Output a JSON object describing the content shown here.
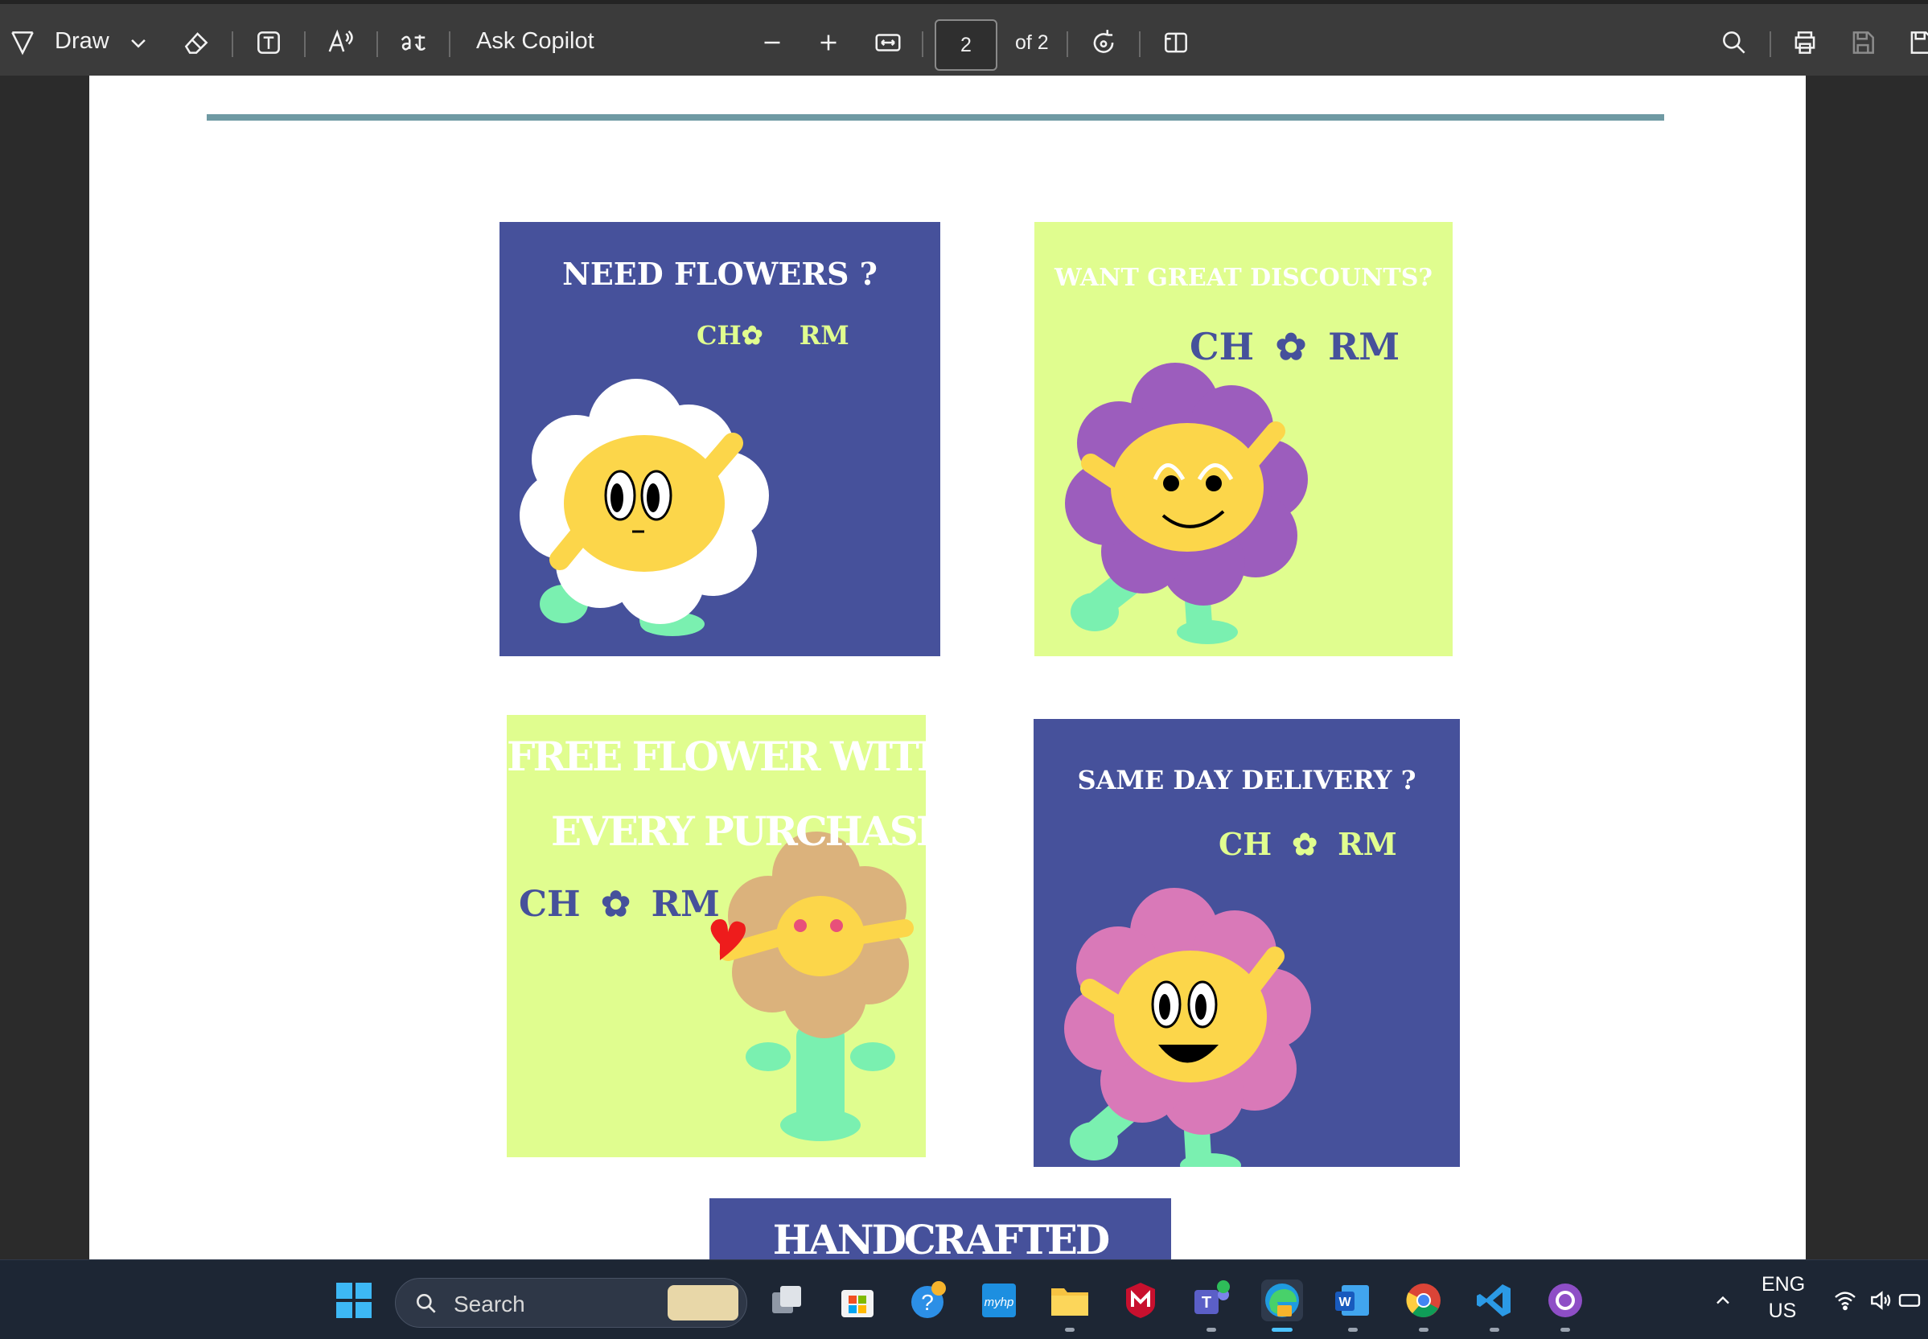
{
  "toolbar": {
    "draw_label": "Draw",
    "ask_copilot_label": "Ask Copilot",
    "page_current": "2",
    "page_total_label": "of 2",
    "icons": [
      "draw-icon",
      "chevron-down-icon",
      "eraser-icon",
      "text-box-icon",
      "read-aloud-icon",
      "translate-icon",
      "zoom-out-icon",
      "zoom-in-icon",
      "fit-width-icon",
      "rotate-icon",
      "page-view-icon",
      "search-icon",
      "print-icon",
      "save-icon",
      "save-as-icon"
    ]
  },
  "document": {
    "cards": [
      {
        "title": "NEED FLOWERS ?",
        "logo_left": "CH",
        "logo_right": "RM",
        "bg": "#46519b",
        "petal_color": "#ffffff"
      },
      {
        "title": "WANT GREAT DISCOUNTS?",
        "logo_left": "CH",
        "logo_right": "RM",
        "bg": "#e0fd8f",
        "petal_color": "#9c5dbd"
      },
      {
        "title_line1": "FREE FLOWER WITH",
        "title_line2": "EVERY PURCHASE @",
        "logo_left": "CH",
        "logo_right": "RM",
        "bg": "#e0fd8f",
        "petal_color": "#dbb27c"
      },
      {
        "title": "SAME DAY DELIVERY ?",
        "logo_left": "CH",
        "logo_right": "RM",
        "bg": "#46519b",
        "petal_color": "#d979b8"
      },
      {
        "title": "HANDCRAFTED",
        "bg": "#46519b"
      }
    ],
    "colors": {
      "navy": "#46519b",
      "lime": "#e0fd8f",
      "face": "#fcd64a",
      "leg": "#7af0b0",
      "rule": "#6f9aa3"
    }
  },
  "taskbar": {
    "search_placeholder": "Search",
    "lang_line1": "ENG",
    "lang_line2": "US",
    "apps": [
      "windows-start",
      "task-view",
      "microsoft-store",
      "get-help",
      "myhp",
      "file-explorer",
      "mcafee",
      "teams",
      "edge",
      "word",
      "chrome",
      "vscode",
      "github-desktop"
    ]
  }
}
